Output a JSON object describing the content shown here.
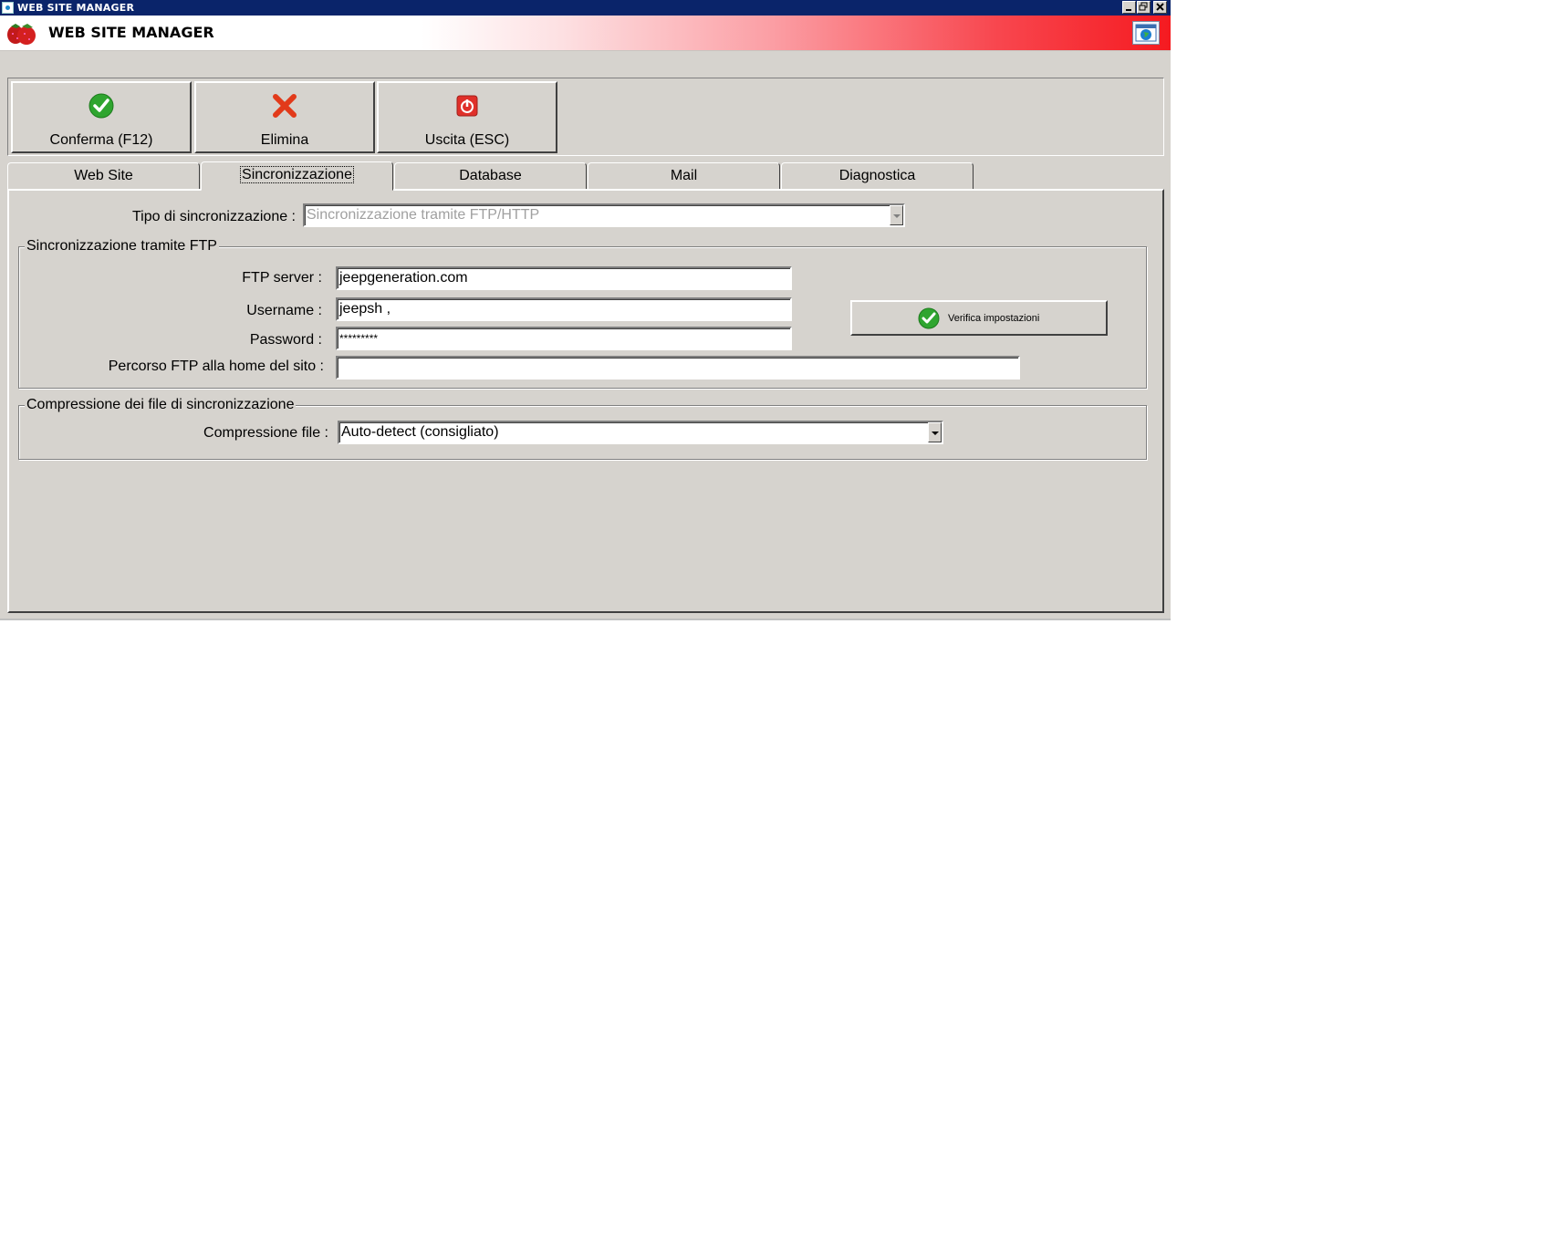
{
  "window": {
    "title": "WEB SITE MANAGER",
    "controls": {
      "minimize": "_",
      "restore": "▫",
      "close": "✕"
    }
  },
  "header": {
    "app_title": "WEB SITE MANAGER",
    "logo_icon": "strawberry-logo-icon",
    "globe_icon": "globe-window-icon"
  },
  "toolbar": {
    "confirm_label": "Conferma (F12)",
    "delete_label": "Elimina",
    "exit_label": "Uscita (ESC)"
  },
  "tabs": [
    {
      "label": "Web Site",
      "active": false
    },
    {
      "label": "Sincronizzazione",
      "active": true
    },
    {
      "label": "Database",
      "active": false
    },
    {
      "label": "Mail",
      "active": false
    },
    {
      "label": "Diagnostica",
      "active": false
    }
  ],
  "sync": {
    "type_label": "Tipo di sincronizzazione :",
    "type_value": "Sincronizzazione tramite FTP/HTTP",
    "ftp_group": {
      "legend": "Sincronizzazione tramite FTP",
      "server_label": "FTP server :",
      "server_value": "jeepgeneration.com",
      "username_label": "Username :",
      "username_value": "jeepsh ,",
      "password_label": "Password :",
      "password_value": "*********",
      "path_label": "Percorso FTP alla home del sito :",
      "path_value": "",
      "verify_label": "Verifica impostazioni"
    },
    "compression_group": {
      "legend": "Compressione dei file di sincronizzazione",
      "label": "Compressione file :",
      "value": "Auto-detect (consigliato)"
    }
  }
}
